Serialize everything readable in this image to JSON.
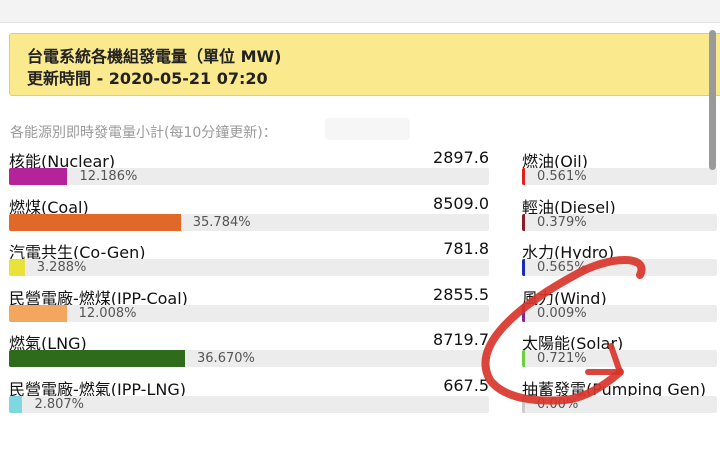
{
  "header": {
    "title": "台電系統各機組發電量（單位 MW)",
    "updated": "更新時間 - 2020-05-21 07:20"
  },
  "subtitle": "各能源別即時發電量小計(每10分鐘更新)：",
  "colors": {
    "header_bg": "#fbe98d",
    "nuclear": "#b5239a",
    "coal": "#e0692a",
    "cogen": "#e8e23a",
    "ipp_coal": "#f3a65e",
    "lng": "#2e6b1a",
    "ipp_lng": "#7fd8e0",
    "oil": "#e02020",
    "diesel": "#8a1d2a",
    "hydro": "#1a2ab5",
    "wind": "#7a2a9a",
    "solar": "#6ad23a",
    "annotation": "#d8352a"
  },
  "left_sources": [
    {
      "name": "核能(Nuclear)",
      "value": "2897.6",
      "percent_text": "12.186%",
      "percent": 12.186,
      "color": "#b5239a"
    },
    {
      "name": "燃煤(Coal)",
      "value": "8509.0",
      "percent_text": "35.784%",
      "percent": 35.784,
      "color": "#e0692a"
    },
    {
      "name": "汽電共生(Co-Gen)",
      "value": "781.8",
      "percent_text": "3.288%",
      "percent": 3.288,
      "color": "#e8e23a"
    },
    {
      "name": "民營電廠-燃煤(IPP-Coal)",
      "value": "2855.5",
      "percent_text": "12.008%",
      "percent": 12.008,
      "color": "#f3a65e"
    },
    {
      "name": "燃氣(LNG)",
      "value": "8719.7",
      "percent_text": "36.670%",
      "percent": 36.67,
      "color": "#2e6b1a"
    },
    {
      "name": "民營電廠-燃氣(IPP-LNG)",
      "value": "667.5",
      "percent_text": "2.807%",
      "percent": 2.807,
      "color": "#7fd8e0"
    }
  ],
  "right_sources": [
    {
      "name": "燃油(Oil)",
      "percent_text": "0.561%",
      "percent": 0.561,
      "color": "#e02020"
    },
    {
      "name": "輕油(Diesel)",
      "percent_text": "0.379%",
      "percent": 0.379,
      "color": "#8a1d2a"
    },
    {
      "name": "水力(Hydro)",
      "percent_text": "0.565%",
      "percent": 0.565,
      "color": "#1a2ab5"
    },
    {
      "name": "風力(Wind)",
      "percent_text": "0.009%",
      "percent": 0.009,
      "color": "#7a2a9a"
    },
    {
      "name": "太陽能(Solar)",
      "percent_text": "0.721%",
      "percent": 0.721,
      "color": "#6ad23a"
    },
    {
      "name": "抽蓄發電(Pumping Gen)",
      "percent_text": "0.00%",
      "percent": 0.0,
      "color": "#cccccc"
    }
  ]
}
